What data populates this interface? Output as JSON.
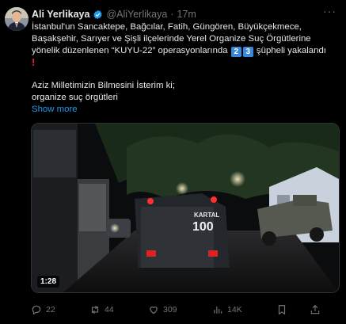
{
  "tweet": {
    "author_name": "Ali Yerlikaya",
    "handle": "@AliYerlikaya",
    "separator": "·",
    "time": "17m",
    "line1": "İstanbul'un Sancaktepe, Bağcılar, Fatih, Güngören, Büyükçekmece,",
    "line2": "Başakşehir, Sarıyer ve Şişli ilçelerinde Yerel Organize Suç Örgütlerine",
    "line3_before": "yönelik düzenlenen “KUYU-22” operasyonlarında",
    "num_digit_1": "2",
    "num_digit_2": "3",
    "line3_after": "şüpheli yakalandı",
    "line4": "Aziz Milletimizin Bilmesini İsterim ki;",
    "line5": "organize suç örgütleri",
    "show_more": "Show more"
  },
  "media": {
    "duration": "1:28",
    "vehicle_text": "KARTAL",
    "vehicle_number": "100"
  },
  "actions": {
    "replies": "22",
    "reposts": "44",
    "likes": "309",
    "views": "14K"
  },
  "colors": {
    "background": "#000000",
    "text": "#e7e9ea",
    "muted": "#71767b",
    "link": "#1d9bf0",
    "verified": "#1d9bf0",
    "keycap": "#3a86d9",
    "alert": "#e0242f"
  }
}
